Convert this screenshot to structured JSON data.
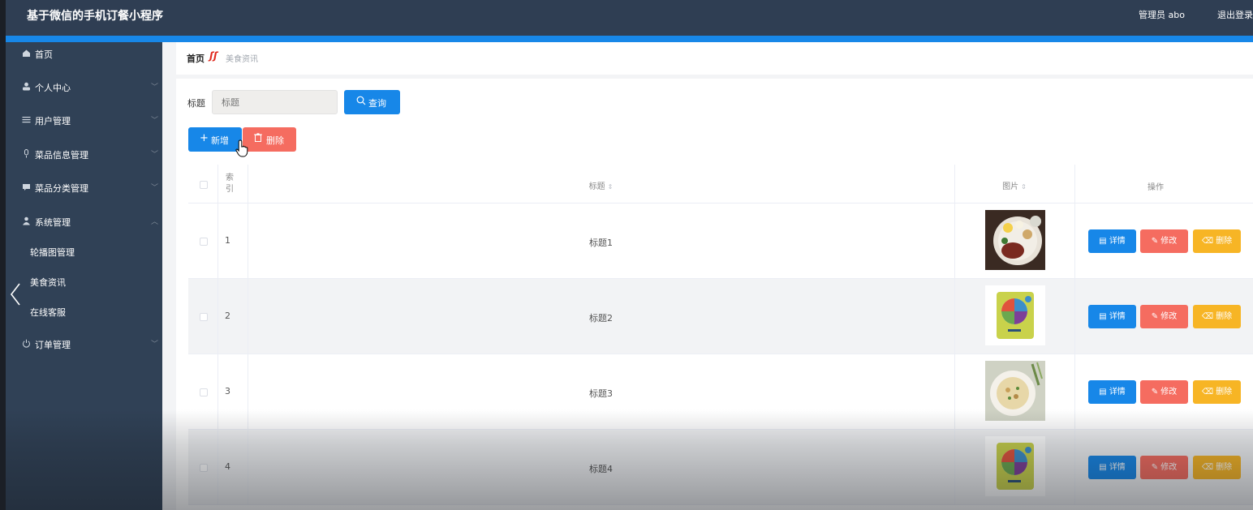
{
  "app": {
    "title": "基于微信的手机订餐小程序",
    "user_label": "管理员 abo",
    "logout_label": "退出登录"
  },
  "sidebar": {
    "items": [
      {
        "label": "首页",
        "icon": "home-icon"
      },
      {
        "label": "个人中心",
        "icon": "user-icon"
      },
      {
        "label": "用户管理",
        "icon": "list-icon"
      },
      {
        "label": "菜品信息管理",
        "icon": "microphone-icon"
      },
      {
        "label": "菜品分类管理",
        "icon": "message-icon"
      },
      {
        "label": "系统管理",
        "icon": "users-icon"
      },
      {
        "label": "订单管理",
        "icon": "power-icon"
      }
    ],
    "system_subitems": [
      "轮播图管理",
      "美食资讯",
      "在线客服"
    ]
  },
  "breadcrumb": {
    "home": "首页",
    "current": "美食资讯"
  },
  "search": {
    "label": "标题",
    "placeholder": "标题",
    "button": "查询"
  },
  "actions": {
    "add": "新增",
    "delete": "删除"
  },
  "table": {
    "headers": {
      "index": "索引",
      "title": "标题",
      "image": "图片",
      "operation": "操作"
    },
    "rows": [
      {
        "index": "1",
        "title": "标题1",
        "image": "plated-meal-photo"
      },
      {
        "index": "2",
        "title": "标题2",
        "image": "myplate-nutrition-graphic"
      },
      {
        "index": "3",
        "title": "标题3",
        "image": "soup-bowl-photo"
      },
      {
        "index": "4",
        "title": "标题4",
        "image": "myplate-nutrition-graphic"
      }
    ],
    "row_buttons": {
      "detail": "详情",
      "edit": "修改",
      "delete": "删除"
    }
  },
  "colors": {
    "header_bg": "#2f3e53",
    "sidebar_bg": "#304156",
    "accent_blue": "#1787e8",
    "danger_red": "#f56c60",
    "warning_yellow": "#f7b525"
  }
}
